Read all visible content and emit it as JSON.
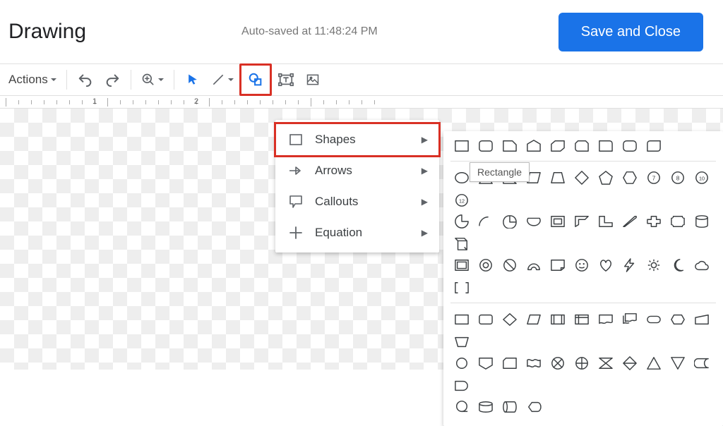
{
  "header": {
    "title": "Drawing",
    "autosave": "Auto-saved at 11:48:24 PM",
    "save_button": "Save and Close"
  },
  "toolbar": {
    "actions_label": "Actions"
  },
  "ruler": {
    "marks": [
      "1",
      "2"
    ]
  },
  "shape_menu": {
    "items": [
      {
        "label": "Shapes"
      },
      {
        "label": "Arrows"
      },
      {
        "label": "Callouts"
      },
      {
        "label": "Equation"
      }
    ]
  },
  "tooltip": "Rectangle",
  "shapes_palette": {
    "row1": [
      "rectangle",
      "rounded-rectangle",
      "snip-corner-rect",
      "home-plate",
      "snip-diag-rect",
      "snip-round-rect",
      "round-single-corner",
      "round-same-side",
      "round-diag"
    ],
    "row2": [
      "ellipse",
      "triangle",
      "right-triangle",
      "parallelogram",
      "trapezoid",
      "diamond",
      "pentagon",
      "hexagon",
      "heptagon",
      "octagon",
      "decagon",
      "dodecagon"
    ],
    "row3": [
      "pie",
      "arc",
      "teardrop",
      "chord",
      "frame",
      "half-frame",
      "l-shape",
      "diag-stripe",
      "cross",
      "plaque",
      "can",
      "cube"
    ],
    "row4": [
      "bevel",
      "donut",
      "no-symbol",
      "block-arc",
      "folded-corner",
      "smiley",
      "heart",
      "lightning",
      "sun",
      "moon",
      "cloud",
      "double-bracket"
    ],
    "row5": [
      "flowchart-process",
      "flowchart-alt-process",
      "flowchart-decision",
      "flowchart-data",
      "flowchart-predefined",
      "flowchart-internal-storage",
      "flowchart-document",
      "flowchart-multidoc",
      "flowchart-terminator",
      "flowchart-preparation",
      "flowchart-manual-input",
      "flowchart-manual-op"
    ],
    "row6": [
      "flowchart-connector",
      "flowchart-offpage",
      "flowchart-card",
      "flowchart-tape",
      "flowchart-summing",
      "flowchart-or",
      "flowchart-collate",
      "flowchart-sort",
      "flowchart-extract",
      "flowchart-merge",
      "flowchart-stored-data",
      "flowchart-delay"
    ],
    "row7": [
      "flowchart-seq-access",
      "flowchart-magnetic-disk",
      "flowchart-direct-access",
      "flowchart-display"
    ]
  }
}
